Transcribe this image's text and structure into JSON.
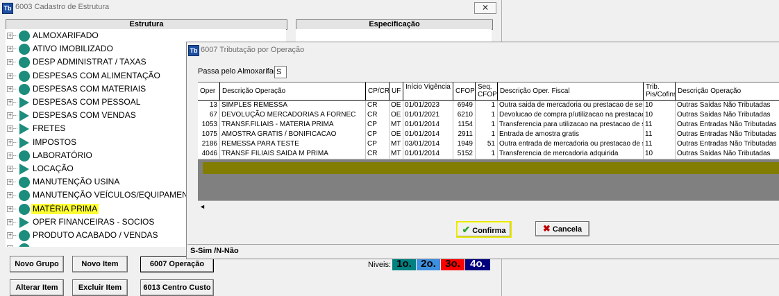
{
  "main_window": {
    "title": "6003 Cadastro de Estrutura",
    "app_icon_text": "Tb",
    "close_symbol": "✕",
    "panels": {
      "estrutura": "Estrutura",
      "especificacao": "Especificação"
    },
    "tree": [
      {
        "label": "ALMOXARIFADO",
        "shape": "circle"
      },
      {
        "label": "ATIVO IMOBILIZADO",
        "shape": "circle"
      },
      {
        "label": "DESP ADMINISTRAT / TAXAS",
        "shape": "circle"
      },
      {
        "label": "DESPESAS COM ALIMENTAÇÃO",
        "shape": "circle"
      },
      {
        "label": "DESPESAS COM MATERIAIS",
        "shape": "circle"
      },
      {
        "label": "DESPESAS COM PESSOAL",
        "shape": "arrow"
      },
      {
        "label": "DESPESAS COM VENDAS",
        "shape": "arrow"
      },
      {
        "label": "FRETES",
        "shape": "arrow"
      },
      {
        "label": "IMPOSTOS",
        "shape": "arrow"
      },
      {
        "label": "LABORATÓRIO",
        "shape": "circle"
      },
      {
        "label": "LOCAÇÃO",
        "shape": "arrow"
      },
      {
        "label": "MANUTENÇÃO USINA",
        "shape": "circle"
      },
      {
        "label": "MANUTENÇÃO VEÍCULOS/EQUIPAMENTOS",
        "shape": "circle"
      },
      {
        "label": "MATÉRIA PRIMA",
        "shape": "circle",
        "selected": true
      },
      {
        "label": "OPER FINANCEIRAS - SOCIOS",
        "shape": "arrow"
      },
      {
        "label": "PRODUTO ACABADO / VENDAS",
        "shape": "circle"
      },
      {
        "label": "",
        "shape": "circle"
      }
    ],
    "buttons": {
      "novo_grupo": "Novo Grupo",
      "novo_item": "Novo Item",
      "op6007": "6007 Operação",
      "alterar_item": "Alterar Item",
      "excluir_item": "Excluir Item",
      "cc6013": "6013 Centro Custo"
    },
    "niveis": {
      "label": "Niveis:",
      "levels": [
        {
          "text": "1o.",
          "bg": "#008080",
          "fg": "#000000"
        },
        {
          "text": "2o.",
          "bg": "#3d8fe0",
          "fg": "#000000"
        },
        {
          "text": "3o.",
          "bg": "#ff0000",
          "fg": "#000000"
        },
        {
          "text": "4o.",
          "bg": "#00007f",
          "fg": "#ffffff"
        }
      ]
    },
    "colors": {
      "node": "#1c8c7c",
      "selection": "#ffff33"
    }
  },
  "dialog": {
    "title": "6007 Tributação por Operação",
    "app_icon_text": "Tb",
    "almox_label": "Passa pelo Almoxarifado:",
    "almox_value": "S",
    "columns": [
      "Oper",
      "Descrição Operação",
      "CP/CR",
      "UF",
      "Início Vigência",
      "CFOP",
      "Seq. CFOP",
      "Descrição Oper. Fiscal",
      "Trib. Pis/Cofins",
      "Descrição Operação"
    ],
    "rows": [
      [
        "13",
        "SIMPLES REMESSA",
        "CR",
        "OE",
        "01/01/2023",
        "6949",
        "1",
        "Outra saida de mercadoria ou prestacao de servico",
        "10",
        "Outras Saídas Não Tributadas"
      ],
      [
        "67",
        "DEVOLUÇÃO MERCADORIAS A FORNEC",
        "CR",
        "OE",
        "01/01/2021",
        "6210",
        "1",
        "Devolucao de compra p/utilizacao na prestacao de",
        "10",
        "Outras Saídas Não Tributadas"
      ],
      [
        "1053",
        "TRANSF.FILIAIS - MATERIA PRIMA",
        "CP",
        "MT",
        "01/01/2014",
        "1154",
        "1",
        "Transferencia para utilizacao na prestacao de serv",
        "11",
        "Outras Entradas Não Tributadas"
      ],
      [
        "1075",
        "AMOSTRA GRATIS / BONIFICACAO",
        "CP",
        "OE",
        "01/01/2014",
        "2911",
        "1",
        "Entrada de amostra gratis",
        "11",
        "Outras Entradas Não Tributadas"
      ],
      [
        "2186",
        "REMESSA PARA TESTE",
        "CP",
        "MT",
        "03/01/2014",
        "1949",
        "51",
        "Outra entrada de mercadoria ou prestacao de serv",
        "11",
        "Outras Entradas Não Tributadas"
      ],
      [
        "4046",
        "TRANSF FILIAIS SAIDA M PRIMA",
        "CR",
        "MT",
        "01/01/2014",
        "5152",
        "1",
        "Transferencia de mercadoria adquirida",
        "10",
        "Outras Saídas Não Tributadas"
      ]
    ],
    "confirm_label": "Confirma",
    "cancel_label": "Cancela",
    "status_text": "S-Sim /N-Não",
    "scroll_left_arrow": "◄"
  }
}
